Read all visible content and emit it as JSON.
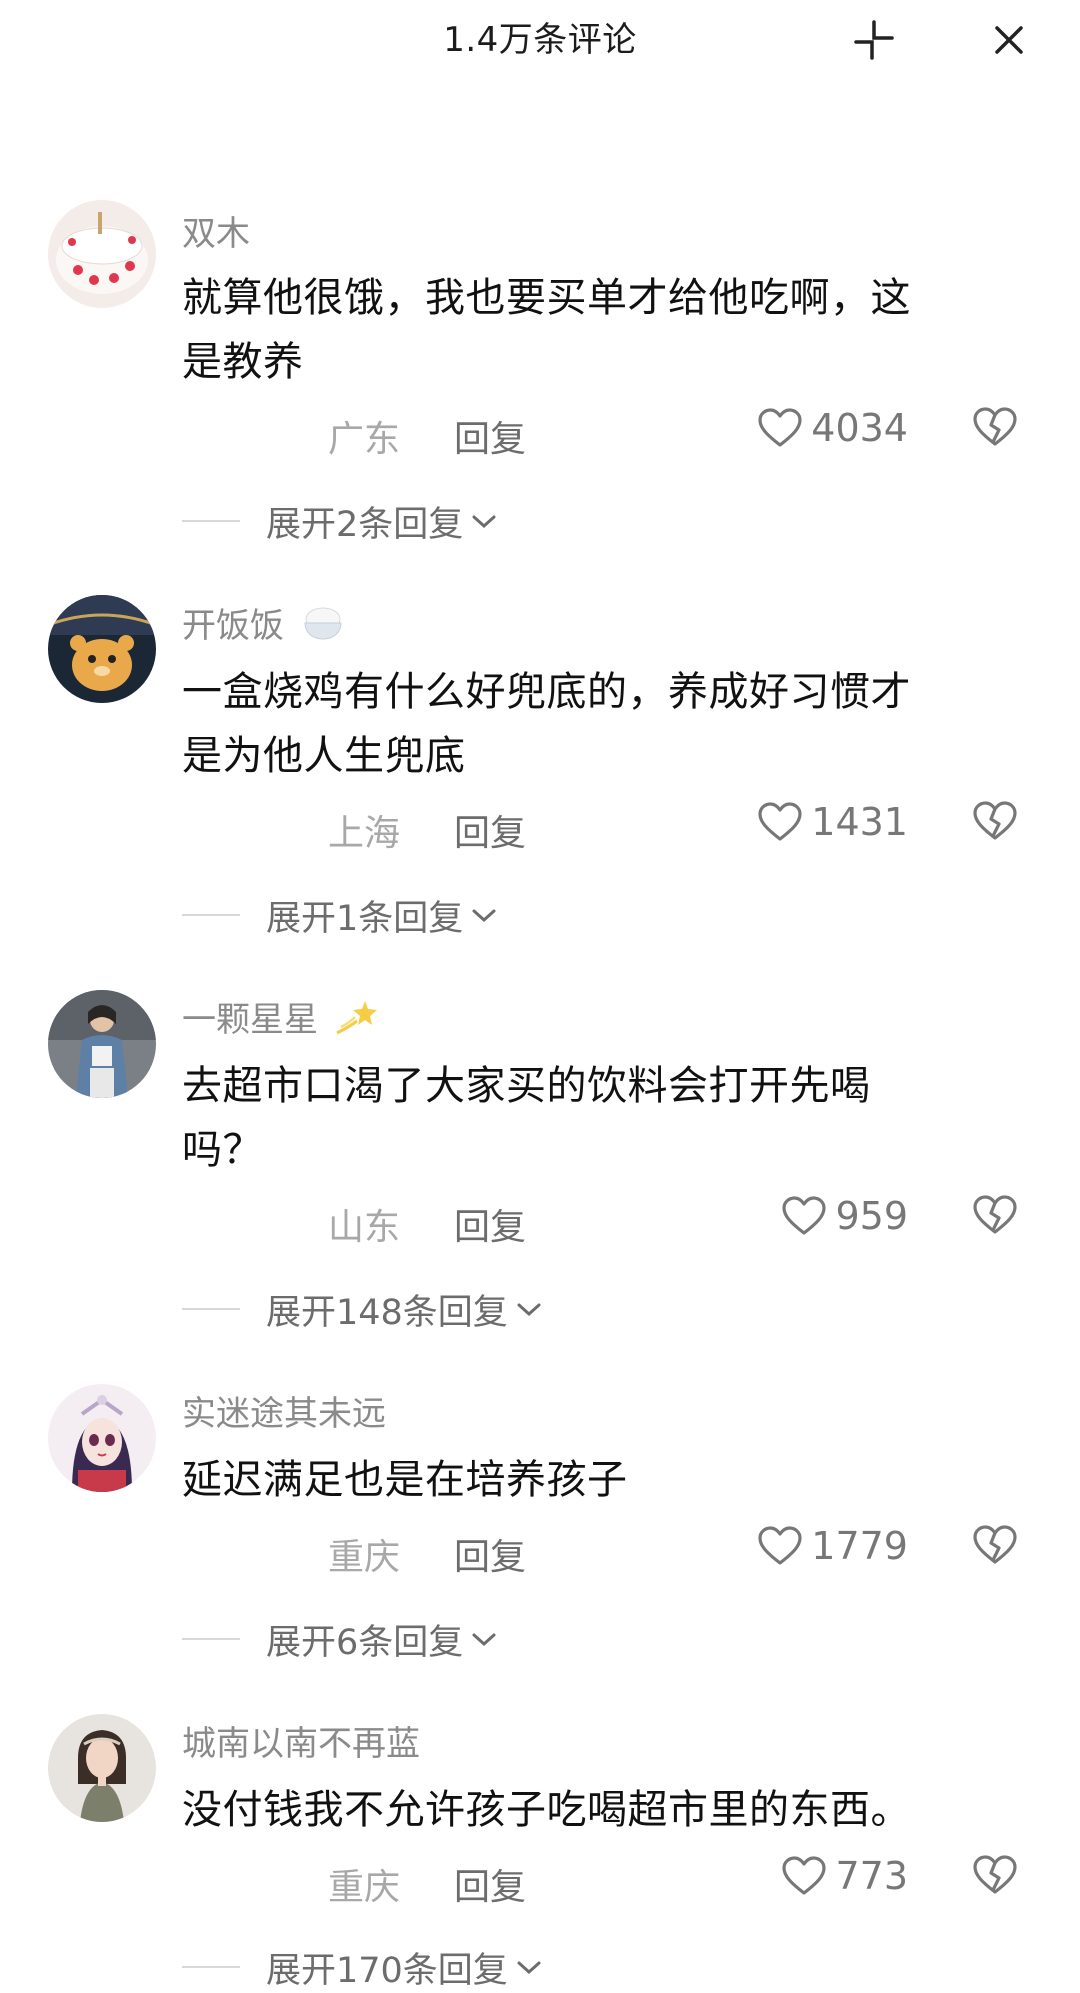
{
  "header": {
    "title": "1.4万条评论"
  },
  "comments": [
    {
      "username": "双木",
      "emoji": "",
      "text_lines": [
        "就算他很饿，我也要买单才给他吃啊，这",
        "是教养"
      ],
      "location": "广东",
      "reply_label": "回复",
      "likes": "4034",
      "expand_label": "展开2条回复"
    },
    {
      "username": "开饭饭",
      "emoji": "rice-bowl-emoji",
      "text_lines": [
        "一盒烧鸡有什么好兜底的，养成好习惯才",
        "是为他人生兜底"
      ],
      "location": "上海",
      "reply_label": "回复",
      "likes": "1431",
      "expand_label": "展开1条回复"
    },
    {
      "username": "一颗星星",
      "emoji": "dizzy-star-emoji",
      "text_lines": [
        "去超市口渴了大家买的饮料会打开先喝",
        "吗？"
      ],
      "location": "山东",
      "reply_label": "回复",
      "likes": "959",
      "expand_label": "展开148条回复"
    },
    {
      "username": "实迷途其未远",
      "emoji": "",
      "text_lines": [
        "延迟满足也是在培养孩子"
      ],
      "location": "重庆",
      "reply_label": "回复",
      "likes": "1779",
      "expand_label": "展开6条回复"
    },
    {
      "username": "城南以南不再蓝",
      "emoji": "",
      "text_lines": [
        "没付钱我不允许孩子吃喝超市里的东西。"
      ],
      "location": "重庆",
      "reply_label": "回复",
      "likes": "773",
      "expand_label": "展开170条回复"
    }
  ]
}
